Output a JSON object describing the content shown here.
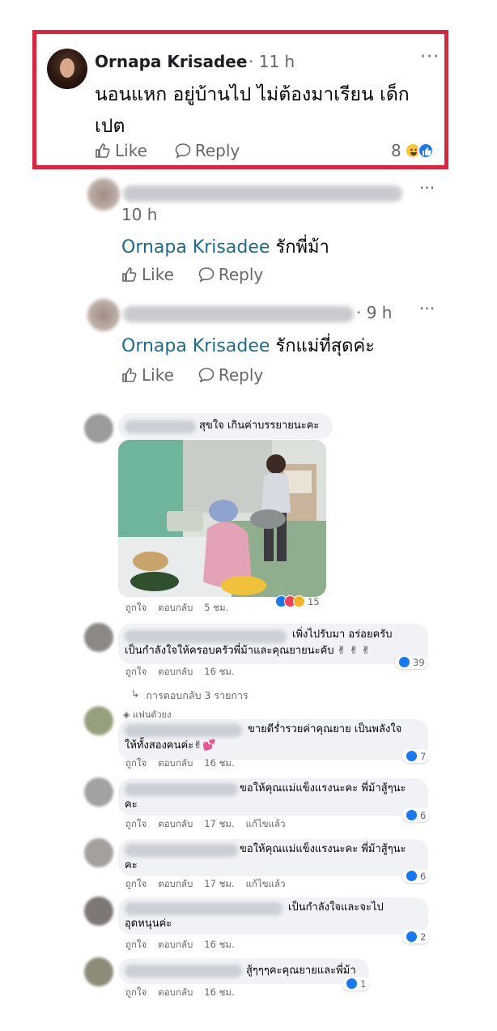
{
  "main_comment": {
    "author": "Ornapa Krisadee",
    "time": "· 11 h",
    "text_line1": "นอนแหก  อยู่บ้านไป ไม่ต้องมาเรียน เด็ก",
    "text_line2": "เปต",
    "like_label": "Like",
    "reply_label": "Reply",
    "reaction_count": "8",
    "more": "···"
  },
  "replies": [
    {
      "time": "10 h",
      "mention": "Ornapa Krisadee",
      "text": "รักพี่ม้า",
      "like_label": "Like",
      "reply_label": "Reply",
      "more": "···"
    },
    {
      "time": "· 9 h",
      "mention": "Ornapa Krisadee",
      "text": "รักแม่ที่สุดค่ะ",
      "like_label": "Like",
      "reply_label": "Reply",
      "more": "···"
    }
  ],
  "thread": [
    {
      "text": "สุขใจ เกินค่าบรรยายนะคะ",
      "like": "ถูกใจ",
      "reply": "ตอบกลับ",
      "time": "5 ชม.",
      "reactions": "15"
    },
    {
      "line1": "เพิ่งไปรับมา อร่อยครับ",
      "line2": "เป็นกำลังใจให้ครอบครัวพี่ม้าและคุณยายนะคับ ✌ ✌ ✌",
      "like": "ถูกใจ",
      "reply": "ตอบกลับ",
      "time": "16 ชม.",
      "reactions": "39",
      "more_replies": "การตอบกลับ 3 รายการ"
    },
    {
      "badge": "แฟนตัวยง",
      "line1": "ขายดีร่ำรวยค่าคุณยาย เป็นพลังใจ",
      "line2": "ให้ทั้งสองคนค่ะ✌💕",
      "like": "ถูกใจ",
      "reply": "ตอบกลับ",
      "time": "16 ชม.",
      "reactions": "7"
    },
    {
      "line1": "ขอให้คุณแม่แข็งแรงนะคะ พี่ม้าสู้ๆนะ",
      "line2": "คะ",
      "like": "ถูกใจ",
      "reply": "ตอบกลับ",
      "time": "17 ชม.",
      "edited": "แก้ไขแล้ว",
      "reactions": "6"
    },
    {
      "line1": "ขอให้คุณแม่แข็งแรงนะคะ พี่ม้าสู้ๆนะ",
      "line2": "คะ",
      "like": "ถูกใจ",
      "reply": "ตอบกลับ",
      "time": "17 ชม.",
      "edited": "แก้ไขแล้ว",
      "reactions": "6"
    },
    {
      "line1": "เป็นกำลังใจและจะไป",
      "line2": "อุดหนุนค่ะ",
      "like": "ถูกใจ",
      "reply": "ตอบกลับ",
      "time": "16 ชม.",
      "reactions": "2"
    },
    {
      "line1": "สู้ๆๆๆคะคุณยายและพี่ม้า",
      "like": "ถูกใจ",
      "reply": "ตอบกลับ",
      "time": "16 ชม.",
      "reactions": "1"
    }
  ]
}
